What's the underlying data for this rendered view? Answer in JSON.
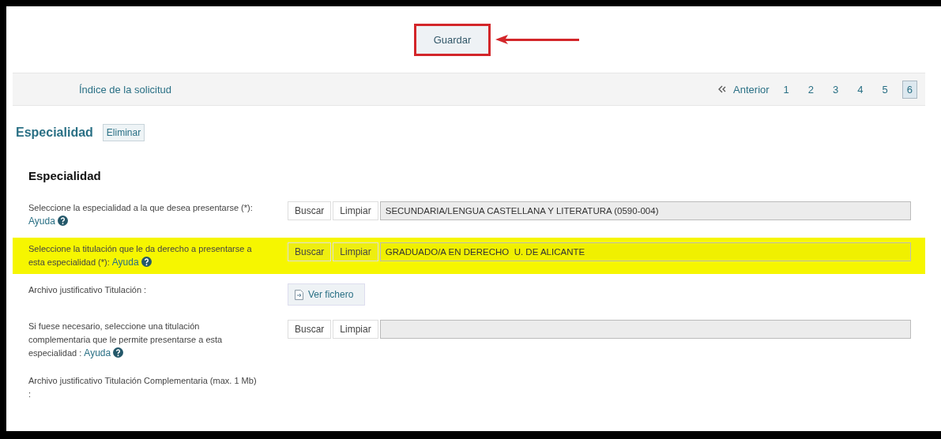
{
  "save_button": {
    "label": "Guardar",
    "highlighted": true
  },
  "nav": {
    "index_link": "Índice de la solicitud",
    "previous": "Anterior",
    "pages": [
      {
        "label": "1",
        "selected": false
      },
      {
        "label": "2",
        "selected": false
      },
      {
        "label": "3",
        "selected": false
      },
      {
        "label": "4",
        "selected": false
      },
      {
        "label": "5",
        "selected": false
      },
      {
        "label": "6",
        "selected": true
      }
    ]
  },
  "section": {
    "title": "Especialidad",
    "delete_button": "Eliminar"
  },
  "subsection": "Especialidad",
  "rows": [
    {
      "kind": "search",
      "label": "Seleccione la especialidad a la que desea presentarse (*):",
      "help_link": "Ayuda",
      "search_button": "Buscar",
      "clear_button": "Limpiar",
      "value": "SECUNDARIA/LENGUA CASTELLANA Y LITERATURA (0590-004)",
      "highlighted": false
    },
    {
      "kind": "search",
      "label": "Seleccione la titulación que le da derecho a presentarse a esta especialidad (*):",
      "help_link": "Ayuda",
      "search_button": "Buscar",
      "clear_button": "Limpiar",
      "value": "GRADUADO/A EN DERECHO  U. DE ALICANTE",
      "highlighted": true
    },
    {
      "kind": "file",
      "label": "Archivo justificativo Titulación :",
      "file_button": "Ver fichero",
      "highlighted": false
    },
    {
      "kind": "search",
      "label": "Si fuese necesario, seleccione una titulación complementaria que le permite presentarse a esta especialidad :",
      "help_link": "Ayuda",
      "search_button": "Buscar",
      "clear_button": "Limpiar",
      "highlighted": false
    },
    {
      "kind": "text",
      "label": "Archivo justificativo Titulación Complementaria (max. 1 Mb) :",
      "highlighted": false
    }
  ]
}
